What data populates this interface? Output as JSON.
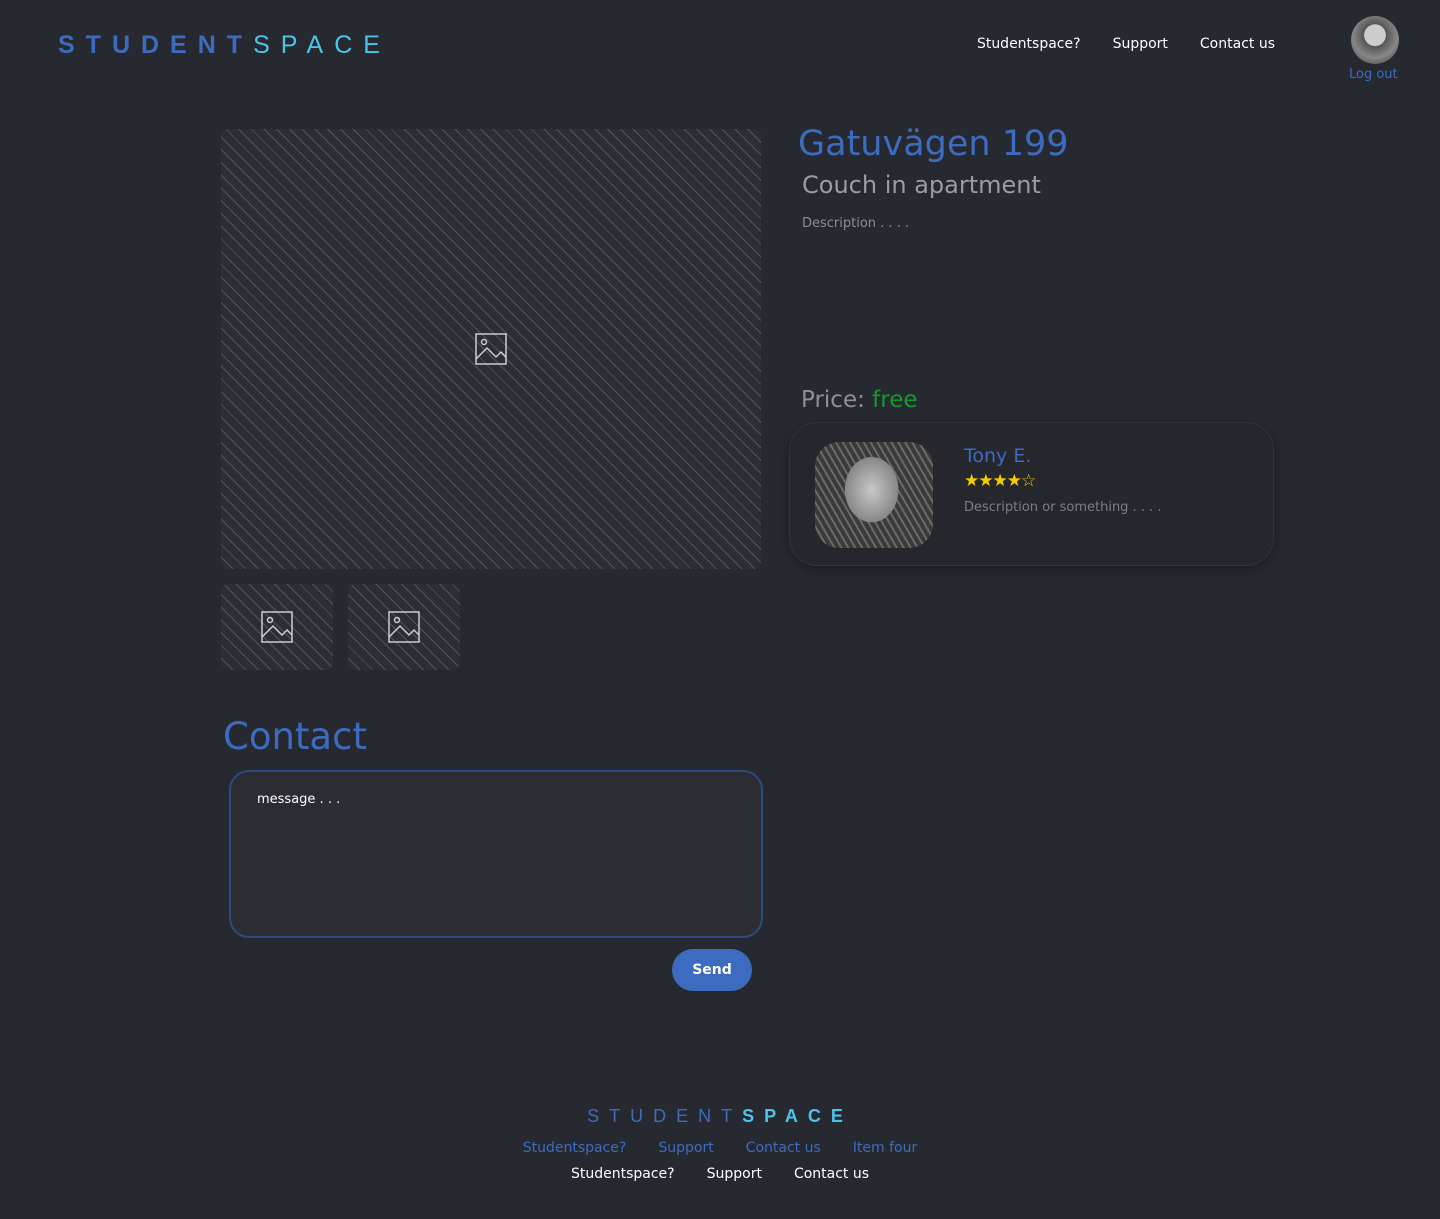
{
  "header": {
    "logo_a": "STUDENT",
    "logo_b": "SPACE",
    "nav": [
      "Studentspace?",
      "Support",
      "Contact us"
    ],
    "logout": "Log out"
  },
  "listing": {
    "title": "Gatuvägen 199",
    "subtitle": "Couch in apartment",
    "description": "Description . . . .",
    "price_label": "Price:",
    "price_value": "free"
  },
  "seller": {
    "name": "Tony E.",
    "rating": 4,
    "rating_max": 5,
    "stars": "★★★★☆",
    "description": "Description or something . . . ."
  },
  "contact": {
    "heading": "Contact",
    "placeholder": "message . . .",
    "send": "Send"
  },
  "footer": {
    "logo_a": "STUDENT",
    "logo_b": "SPACE",
    "links_primary": [
      "Studentspace?",
      "Support",
      "Contact us",
      "Item four"
    ],
    "links_secondary": [
      "Studentspace?",
      "Support",
      "Contact us"
    ]
  },
  "colors": {
    "accent": "#3d6bc0",
    "cyan": "#4cc3ea",
    "price": "#159a2a",
    "star": "#f5cc00"
  }
}
